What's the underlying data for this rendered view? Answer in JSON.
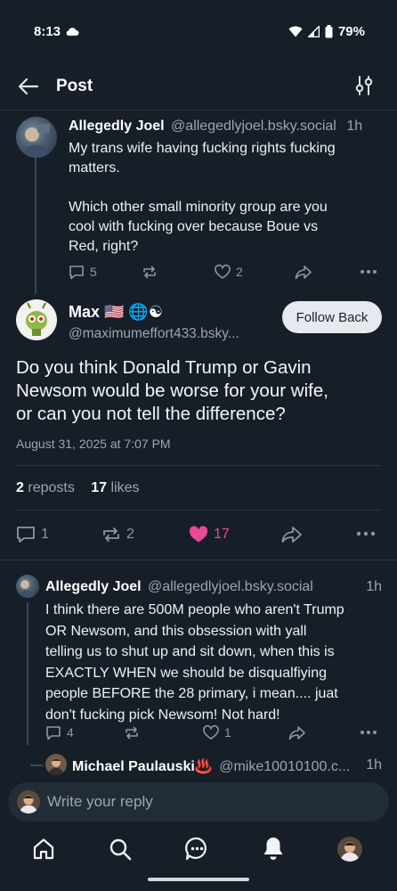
{
  "status": {
    "time": "8:13",
    "battery": "79%"
  },
  "header": {
    "title": "Post"
  },
  "parent_post": {
    "author": "Allegedly Joel",
    "handle": "@allegedlyjoel.bsky.social",
    "time": "1h",
    "text_line1": "My trans wife having fucking rights fucking",
    "text_line2": "matters.",
    "text_line3": "Which other small minority group are you",
    "text_line4": "cool with fucking over because Boue vs",
    "text_line5": "Red, right?",
    "replies": "5",
    "likes": "2"
  },
  "main_post": {
    "author": "Max 🇺🇸 🌐☯",
    "handle": "@maximumeffort433.bsky...",
    "follow_label": "Follow Back",
    "text_line1": "Do you think Donald Trump or Gavin",
    "text_line2": "Newsom would be worse for your wife,",
    "text_line3": "or can you not tell the difference?",
    "timestamp": "August 31, 2025 at 7:07 PM",
    "reposts_count": "2",
    "reposts_label": "reposts",
    "likes_count": "17",
    "likes_label": "likes",
    "reply_count": "1",
    "repost_count": "2",
    "like_count": "17"
  },
  "reply_post": {
    "author": "Allegedly Joel",
    "handle": "@allegedlyjoel.bsky.social",
    "time": "1h",
    "text_line1": "I think there are 500M people who aren't Trump",
    "text_line2": "OR Newsom, and this obsession with yall",
    "text_line3": "telling us to shut up and sit down, when this is",
    "text_line4": "EXACTLY WHEN we should be disqualfiying",
    "text_line5": "people BEFORE the 28 primary, i mean.... juat",
    "text_line6": "don't fucking pick Newsom! Not hard!",
    "replies": "4",
    "likes": "1"
  },
  "nested_reply": {
    "author": "Michael Paulauski♨️",
    "handle": "@mike10010100.c...",
    "time": "1h"
  },
  "reply_bar": {
    "placeholder": "Write your reply"
  },
  "colors": {
    "background": "#161e27",
    "like_active": "#ec4899",
    "muted": "#8c98a5"
  }
}
